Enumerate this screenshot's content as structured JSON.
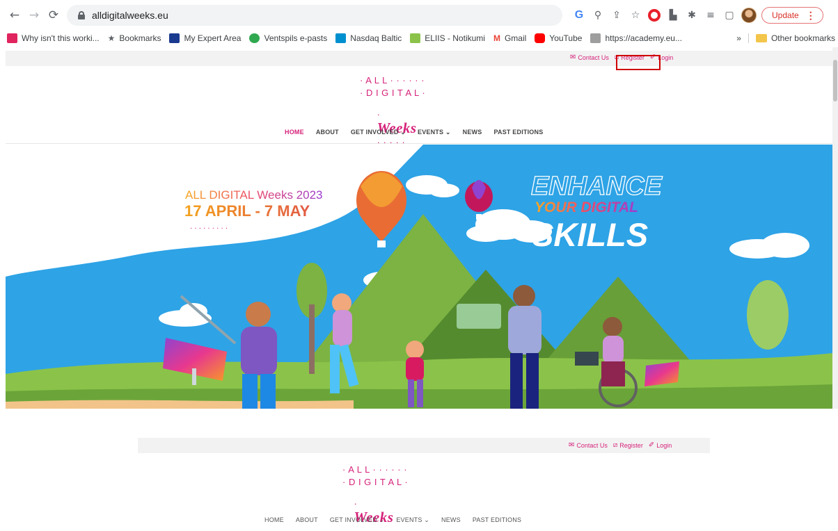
{
  "browser": {
    "url": "alldigitalweeks.eu",
    "update_label": "Update",
    "icons": [
      "back-arrow-icon",
      "forward-arrow-icon",
      "reload-icon",
      "lock-icon",
      "google-icon",
      "zoom-icon",
      "share-icon",
      "star-icon",
      "opera-icon",
      "extension-icon",
      "puzzle-icon",
      "reading-list-icon",
      "side-panel-icon",
      "profile-avatar"
    ]
  },
  "bookmarks": {
    "items": [
      {
        "label": "Why isn't this worki...",
        "color": "#e0245e"
      },
      {
        "label": "Bookmarks",
        "color": "#5f6368"
      },
      {
        "label": "My Expert Area",
        "color": "#1a3a8f"
      },
      {
        "label": "Ventspils e-pasts",
        "color": "#2fa84f"
      },
      {
        "label": "Nasdaq Baltic",
        "color": "#0090d0"
      },
      {
        "label": "ELIIS - Notikumi",
        "color": "#8bc34a"
      },
      {
        "label": "Gmail",
        "color": "#ea4335"
      },
      {
        "label": "YouTube",
        "color": "#ff0000"
      },
      {
        "label": "https://academy.eu...",
        "color": "#9e9e9e"
      }
    ],
    "overflow": "»",
    "other": "Other bookmarks"
  },
  "site": {
    "top_links": {
      "contact": "Contact Us",
      "register": "Register",
      "login": "Login"
    },
    "logo": {
      "line1": "· A L L · · · · · ·",
      "line2": "· D I G I T A L ·",
      "line3_pre": "·",
      "weeks": "Weeks",
      "line3_post": "· · · · ·"
    },
    "nav": {
      "home": "HOME",
      "about": "ABOUT",
      "get_involved": "GET INVOLVED ⌄",
      "events": "EVENTS ⌄",
      "news": "NEWS",
      "past": "PAST EDITIONS"
    },
    "hero": {
      "line1": "ALL DIGITAL Weeks 2023",
      "dates": "17 APRIL - 7 MAY",
      "dots": "·  ·  ·  ·  ·  ·  ·  ·  ·",
      "enhance": "ENHANCE",
      "your_digital": "YOUR DIGITAL",
      "skills": "SKILLS"
    },
    "accent_color": "#d6227a"
  }
}
